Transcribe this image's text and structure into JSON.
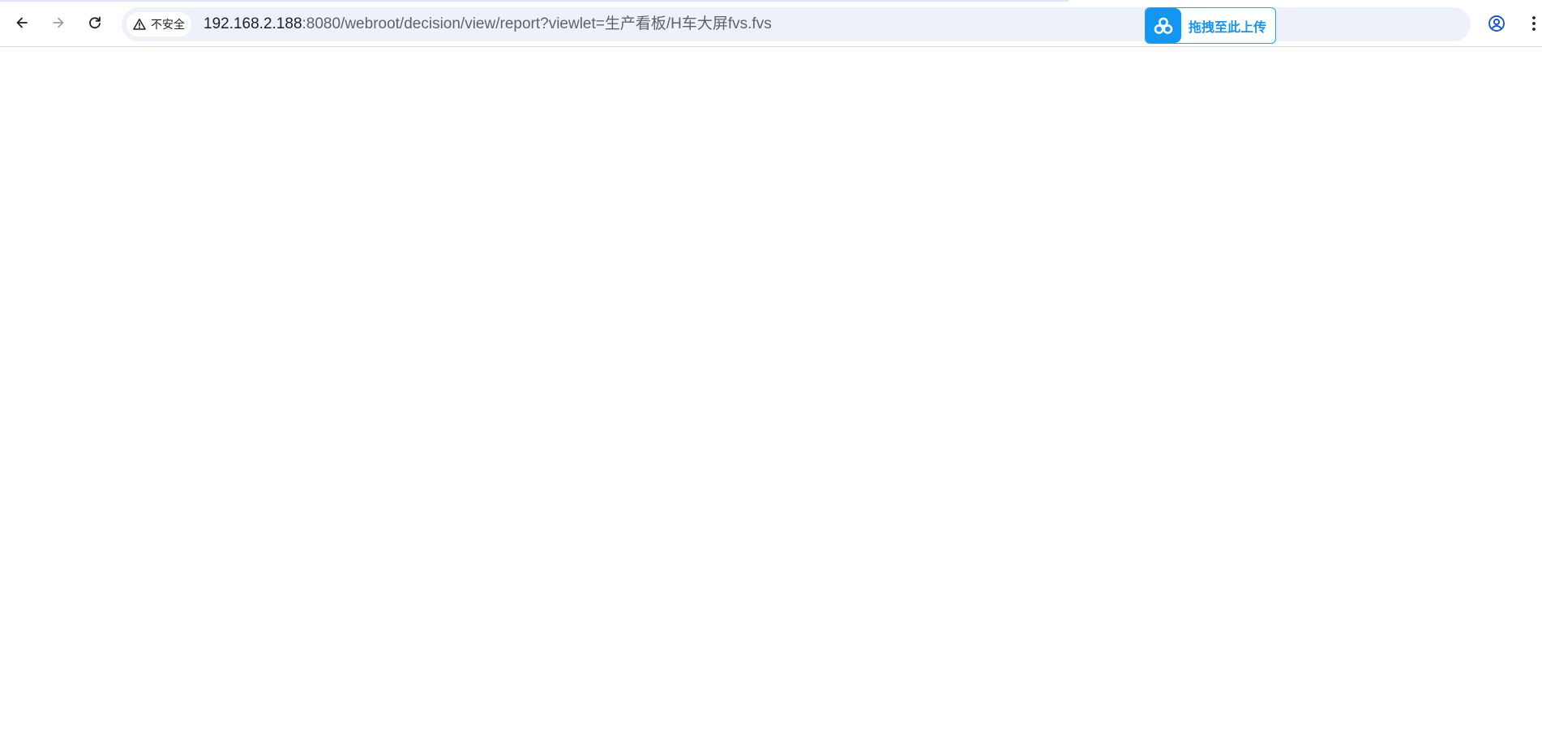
{
  "browser": {
    "security_label": "不安全",
    "url_host": "192.168.2.188",
    "url_path": ":8080/webroot/decision/view/report?viewlet=生产看板/H车大屏fvs.fvs"
  },
  "upload_widget": {
    "label": "拖拽至此上传"
  },
  "icons": {
    "back": "arrow-left-icon",
    "forward": "arrow-right-icon",
    "reload": "reload-icon",
    "security": "warning-triangle-icon",
    "bookmark": "star-icon",
    "upload_logo": "cloud-rings-icon",
    "profile": "account-circle-icon",
    "menu": "more-vert-icon"
  },
  "colors": {
    "omnibox_bg": "#edf2fa",
    "upload_accent": "#1296f0",
    "profile_accent": "#1a56c4",
    "forward_disabled": "#9aa0a6"
  }
}
